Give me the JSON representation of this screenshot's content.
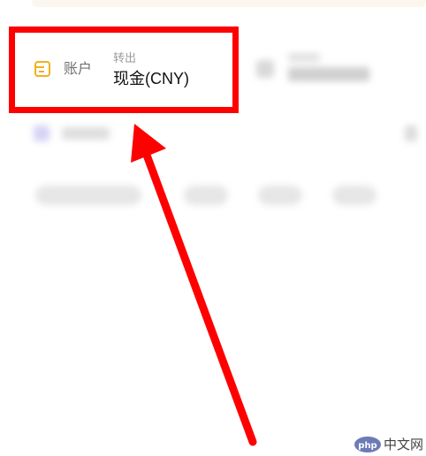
{
  "account": {
    "label": "账户",
    "transfer_caption": "转出",
    "transfer_value": "现金(CNY)"
  },
  "watermark": {
    "logo_text": "php",
    "site_text": "中文网"
  },
  "colors": {
    "highlight": "#ff0000",
    "icon_accent": "#f2b01e",
    "label_gray": "#707070",
    "caption_gray": "#9a9a9a",
    "value_text": "#111111"
  },
  "icons": {
    "account": "wallet-icon"
  }
}
